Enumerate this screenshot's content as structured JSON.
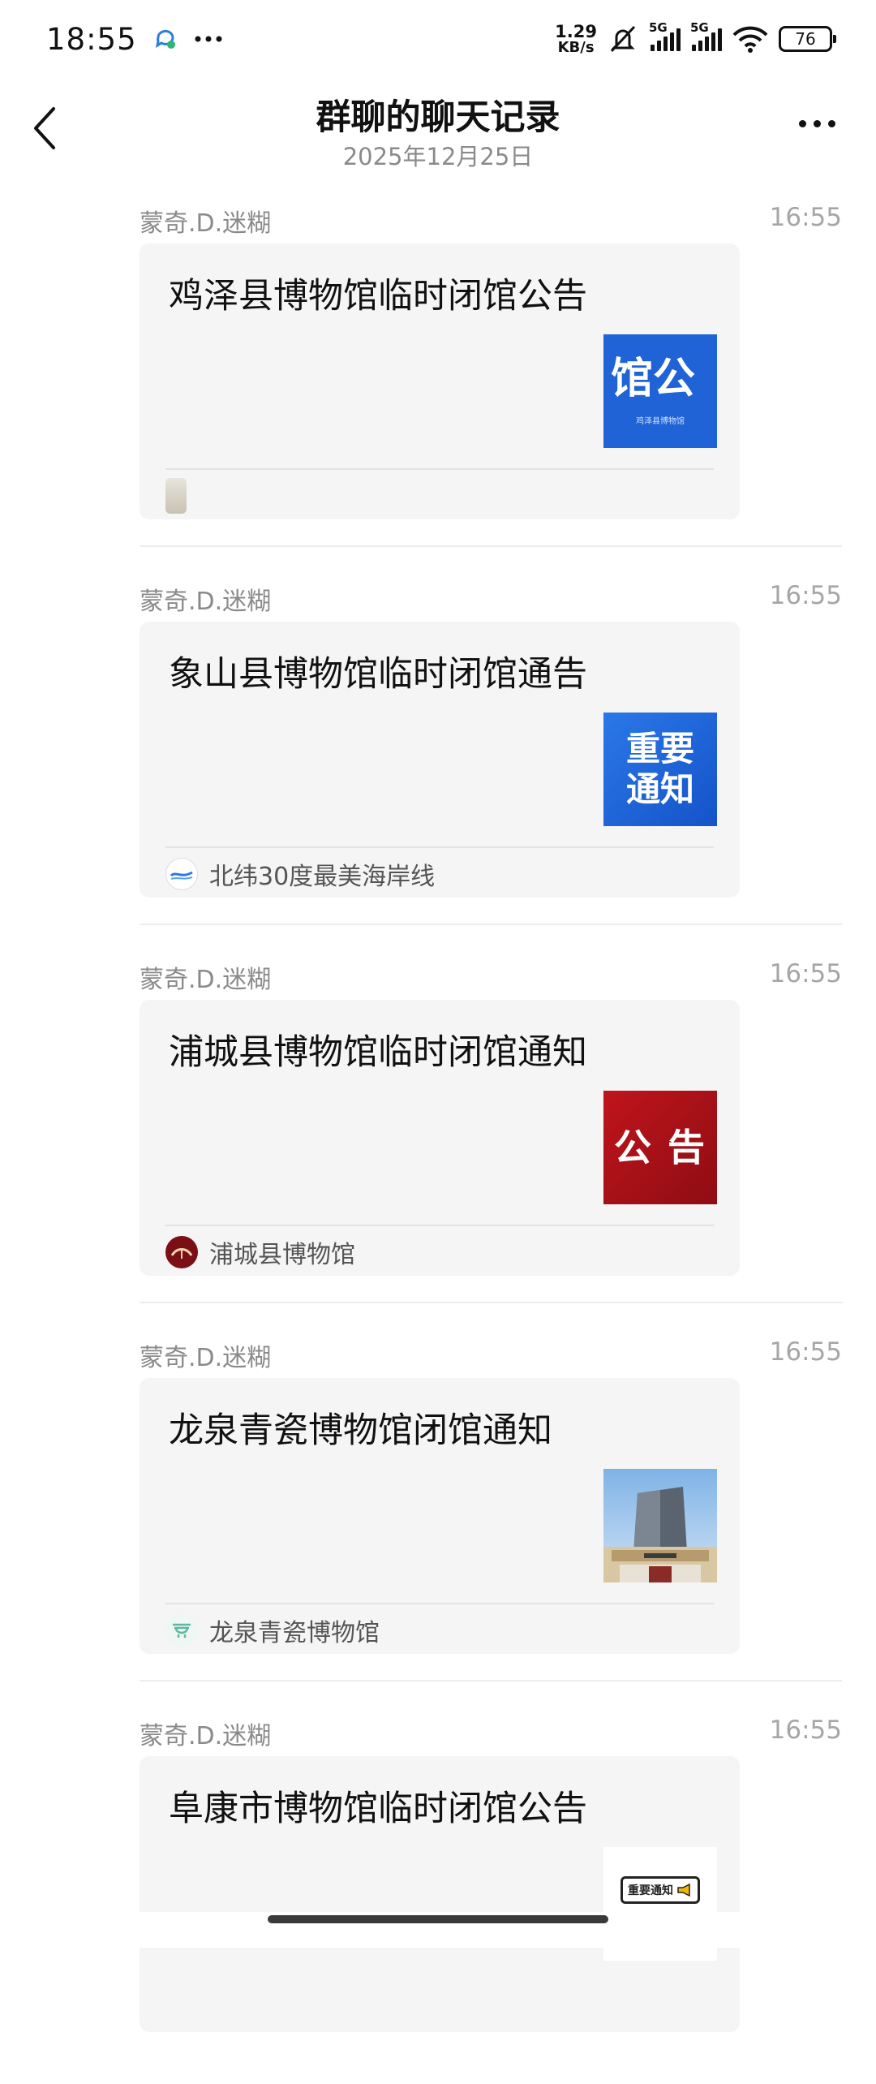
{
  "status_bar": {
    "time": "18:55",
    "net_speed_value": "1.29",
    "net_speed_unit": "KB/s",
    "signal_1_label": "5G",
    "signal_2_label": "5G",
    "battery": "76"
  },
  "header": {
    "title": "群聊的聊天记录",
    "date": "2025年12月25日"
  },
  "messages": [
    {
      "sender": "蒙奇.D.迷糊",
      "time": "16:55",
      "title": "鸡泽县博物馆临时闭馆公告",
      "thumb_text": "馆公",
      "thumb_subtext": "鸡泽县博物馆",
      "source": ""
    },
    {
      "sender": "蒙奇.D.迷糊",
      "time": "16:55",
      "title": "象山县博物馆临时闭馆通告",
      "thumb_text": "重要",
      "thumb_text2": "通知",
      "source": "北纬30度最美海岸线"
    },
    {
      "sender": "蒙奇.D.迷糊",
      "time": "16:55",
      "title": "浦城县博物馆临时闭馆通知",
      "thumb_text": "公 告",
      "source": "浦城县博物馆"
    },
    {
      "sender": "蒙奇.D.迷糊",
      "time": "16:55",
      "title": "龙泉青瓷博物馆闭馆通知",
      "source": "龙泉青瓷博物馆"
    },
    {
      "sender": "蒙奇.D.迷糊",
      "time": "16:55",
      "title": "阜康市博物馆临时闭馆公告",
      "thumb_text": "重要通知"
    }
  ],
  "colors": {
    "card_bg": "#f5f5f5",
    "meta_text": "#8a8a8a",
    "blue_thumb": "#1f63d6",
    "red_thumb": "#b1131b"
  }
}
